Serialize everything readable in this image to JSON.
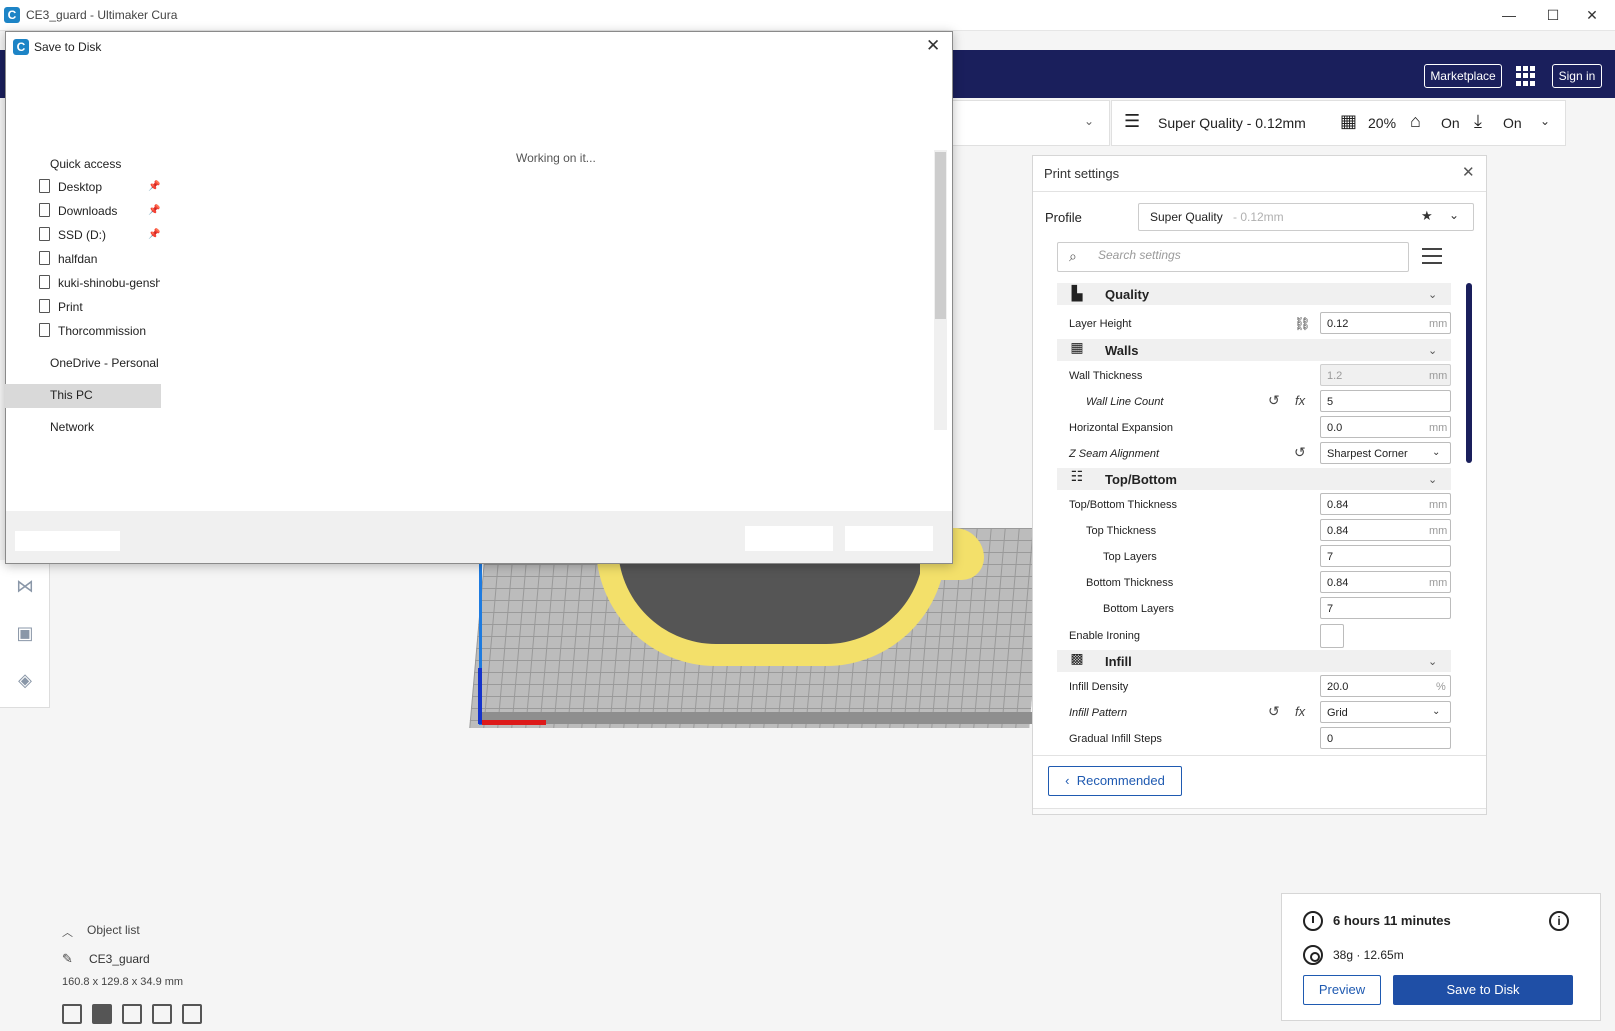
{
  "window": {
    "title": "CE3_guard - Ultimaker Cura",
    "minimize": "—",
    "maximize": "☐",
    "close": "✕"
  },
  "header": {
    "marketplace": "Marketplace",
    "sign_in": "Sign in"
  },
  "stage_bar": {
    "profile": "Super Quality - 0.12mm",
    "infill": "20%",
    "support": "On",
    "adhesion": "On"
  },
  "object_list": {
    "label": "Object list",
    "name": "CE3_guard",
    "dimensions": "160.8 x 129.8 x 34.9 mm"
  },
  "print_settings": {
    "title": "Print settings",
    "profile_label": "Profile",
    "profile_value": "Super Quality",
    "profile_sub": "- 0.12mm",
    "search_placeholder": "Search settings",
    "categories": {
      "quality": "Quality",
      "walls": "Walls",
      "top_bottom": "Top/Bottom",
      "infill": "Infill"
    },
    "settings": [
      {
        "label": "Layer Height",
        "value": "0.12",
        "unit": "mm"
      },
      {
        "label": "Wall Thickness",
        "value": "1.2",
        "unit": "mm"
      },
      {
        "label": "Wall Line Count",
        "value": "5",
        "unit": ""
      },
      {
        "label": "Horizontal Expansion",
        "value": "0.0",
        "unit": "mm"
      },
      {
        "label": "Z Seam Alignment",
        "value": "Sharpest Corner",
        "unit": ""
      },
      {
        "label": "Top/Bottom Thickness",
        "value": "0.84",
        "unit": "mm"
      },
      {
        "label": "Top Thickness",
        "value": "0.84",
        "unit": "mm"
      },
      {
        "label": "Top Layers",
        "value": "7",
        "unit": ""
      },
      {
        "label": "Bottom Thickness",
        "value": "0.84",
        "unit": "mm"
      },
      {
        "label": "Bottom Layers",
        "value": "7",
        "unit": ""
      },
      {
        "label": "Enable Ironing",
        "value": "",
        "unit": ""
      },
      {
        "label": "Infill Density",
        "value": "20.0",
        "unit": "%"
      },
      {
        "label": "Infill Pattern",
        "value": "Grid",
        "unit": ""
      },
      {
        "label": "Gradual Infill Steps",
        "value": "0",
        "unit": ""
      }
    ],
    "recommended": "Recommended"
  },
  "estimate": {
    "time": "6 hours 11 minutes",
    "material": "38g · 12.65m",
    "preview": "Preview",
    "save": "Save to Disk"
  },
  "dialog": {
    "title": "Save to Disk",
    "status": "Working on it...",
    "nav": {
      "quick_access": "Quick access",
      "items": [
        "Desktop",
        "Downloads",
        "SSD (D:)",
        "halfdan",
        "kuki-shinobu-gensh",
        "Print",
        "Thorcommission"
      ],
      "onedrive": "OneDrive - Personal",
      "this_pc": "This PC",
      "network": "Network"
    }
  }
}
